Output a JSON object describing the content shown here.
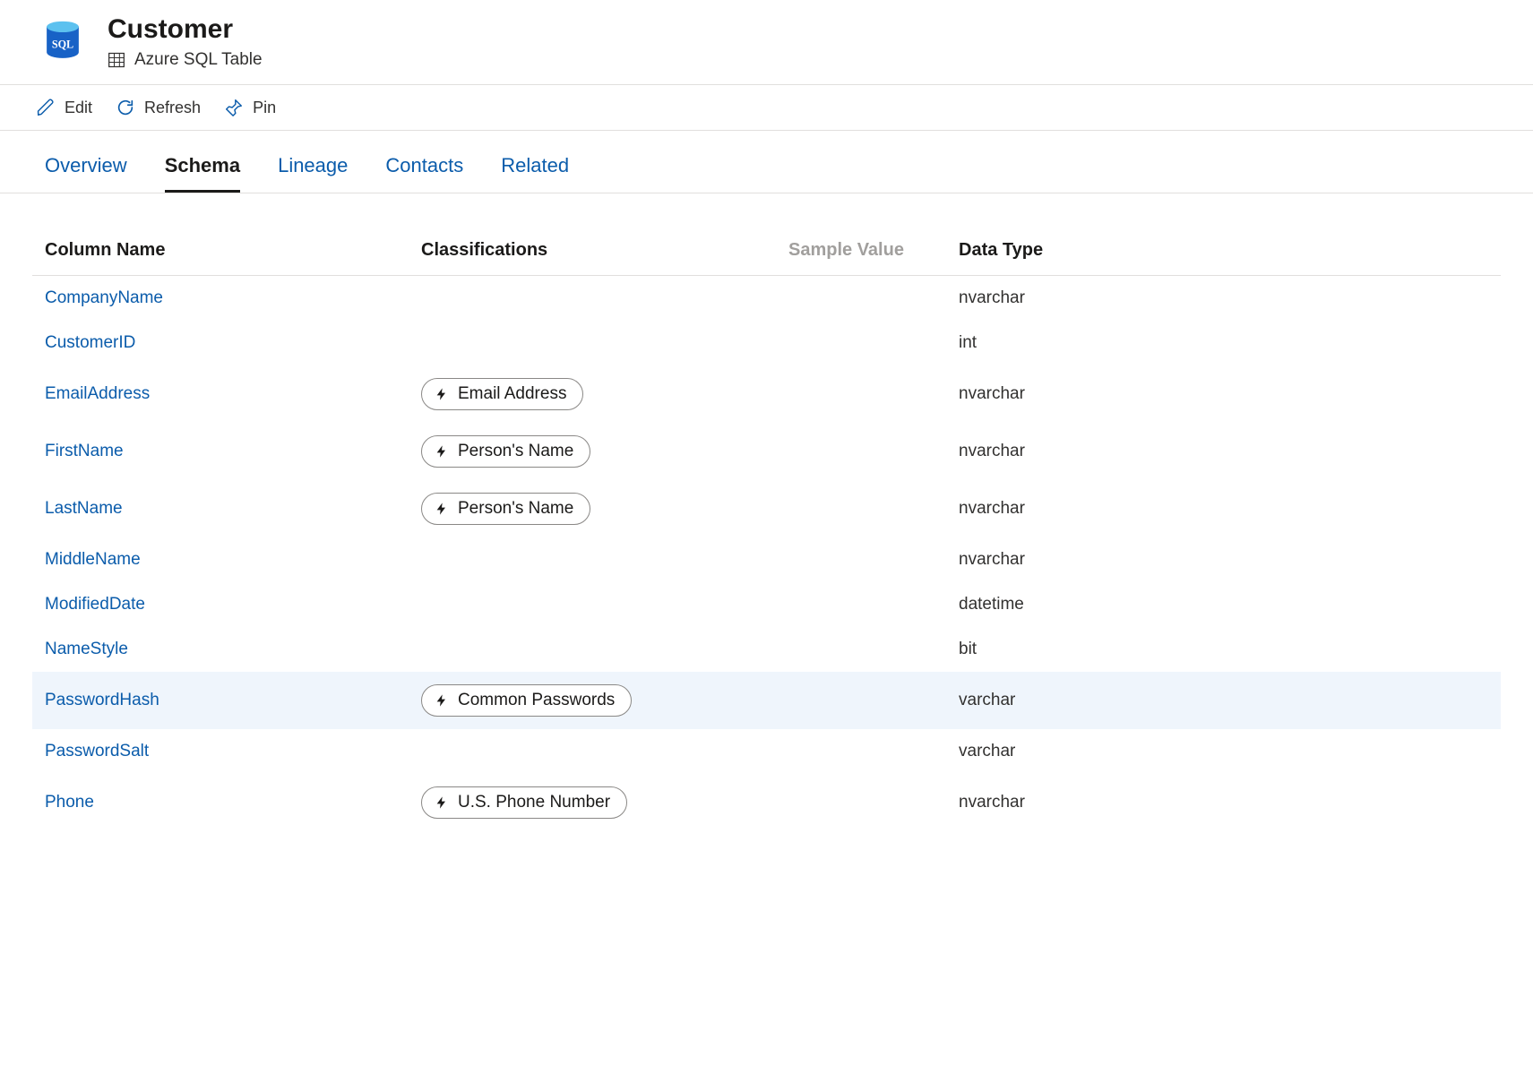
{
  "header": {
    "title": "Customer",
    "subtitle": "Azure SQL Table"
  },
  "toolbar": {
    "edit": "Edit",
    "refresh": "Refresh",
    "pin": "Pin"
  },
  "tabs": {
    "overview": "Overview",
    "schema": "Schema",
    "lineage": "Lineage",
    "contacts": "Contacts",
    "related": "Related",
    "active": "schema"
  },
  "tableHeaders": {
    "columnName": "Column Name",
    "classifications": "Classifications",
    "sampleValue": "Sample Value",
    "dataType": "Data Type"
  },
  "rows": [
    {
      "name": "CompanyName",
      "classification": null,
      "sample": "",
      "type": "nvarchar",
      "highlight": false
    },
    {
      "name": "CustomerID",
      "classification": null,
      "sample": "",
      "type": "int",
      "highlight": false
    },
    {
      "name": "EmailAddress",
      "classification": "Email Address",
      "sample": "",
      "type": "nvarchar",
      "highlight": false
    },
    {
      "name": "FirstName",
      "classification": "Person's Name",
      "sample": "",
      "type": "nvarchar",
      "highlight": false
    },
    {
      "name": "LastName",
      "classification": "Person's Name",
      "sample": "",
      "type": "nvarchar",
      "highlight": false
    },
    {
      "name": "MiddleName",
      "classification": null,
      "sample": "",
      "type": "nvarchar",
      "highlight": false
    },
    {
      "name": "ModifiedDate",
      "classification": null,
      "sample": "",
      "type": "datetime",
      "highlight": false
    },
    {
      "name": "NameStyle",
      "classification": null,
      "sample": "",
      "type": "bit",
      "highlight": false
    },
    {
      "name": "PasswordHash",
      "classification": "Common Passwords",
      "sample": "",
      "type": "varchar",
      "highlight": true
    },
    {
      "name": "PasswordSalt",
      "classification": null,
      "sample": "",
      "type": "varchar",
      "highlight": false
    },
    {
      "name": "Phone",
      "classification": "U.S. Phone Number",
      "sample": "",
      "type": "nvarchar",
      "highlight": false
    }
  ]
}
